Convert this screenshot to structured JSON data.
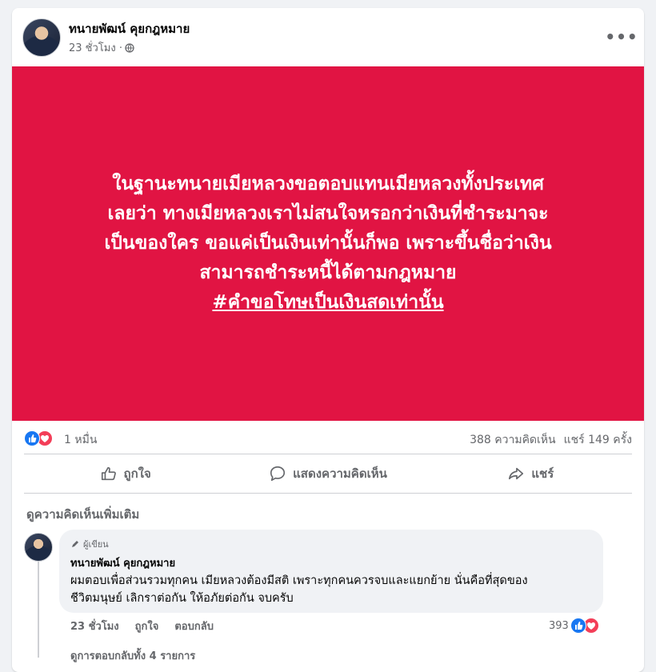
{
  "post": {
    "author": "ทนายพัฒน์ คุยกฎหมาย",
    "time": "23 ชั่วโมง ·",
    "privacy_icon": "globe-icon",
    "more_icon": "more-horizontal-icon",
    "banner_color": "#e11443",
    "banner_lines": [
      "ในฐานะทนายเมียหลวงขอตอบแทนเมียหลวงทั้งประเทศ",
      "เลยว่า ทางเมียหลวงเราไม่สนใจหรอกว่าเงินที่ชำระมาจะ",
      "เป็นของใคร ขอแค่เป็นเงินเท่านั้นก็พอ เพราะขึ้นชื่อว่าเงิน",
      "สามารถชำระหนี้ได้ตามกฎหมาย"
    ],
    "hashtag": "#คำขอโทษเป็นเงินสดเท่านั้น"
  },
  "stats": {
    "reactions": "1 หมื่น",
    "comments": "388 ความคิดเห็น",
    "shares": "แชร์ 149 ครั้ง"
  },
  "actions": {
    "like": "ถูกใจ",
    "comment": "แสดงความคิดเห็น",
    "share": "แชร์"
  },
  "comments": {
    "more_label": "ดูความคิดเห็นเพิ่มเติม",
    "items": [
      {
        "badge": "ผู้เขียน",
        "author": "ทนายพัฒน์ คุยกฎหมาย",
        "text_lines": [
          "ผมตอบเพื่อส่วนรวมทุกคน เมียหลวงต้องมีสติ เพราะทุกคนควรจบและแยกย้าย นั่นคือที่สุดของ",
          "ชีวิตมนุษย์ เลิกราต่อกัน ให้อภัยต่อกัน จบครับ"
        ],
        "time": "23 ชั่วโมง",
        "like_label": "ถูกใจ",
        "reply_label": "ตอบกลับ",
        "reaction_count": "393",
        "replies_peek": "ดูการตอบกลับทั้ง 4 รายการ"
      }
    ]
  }
}
